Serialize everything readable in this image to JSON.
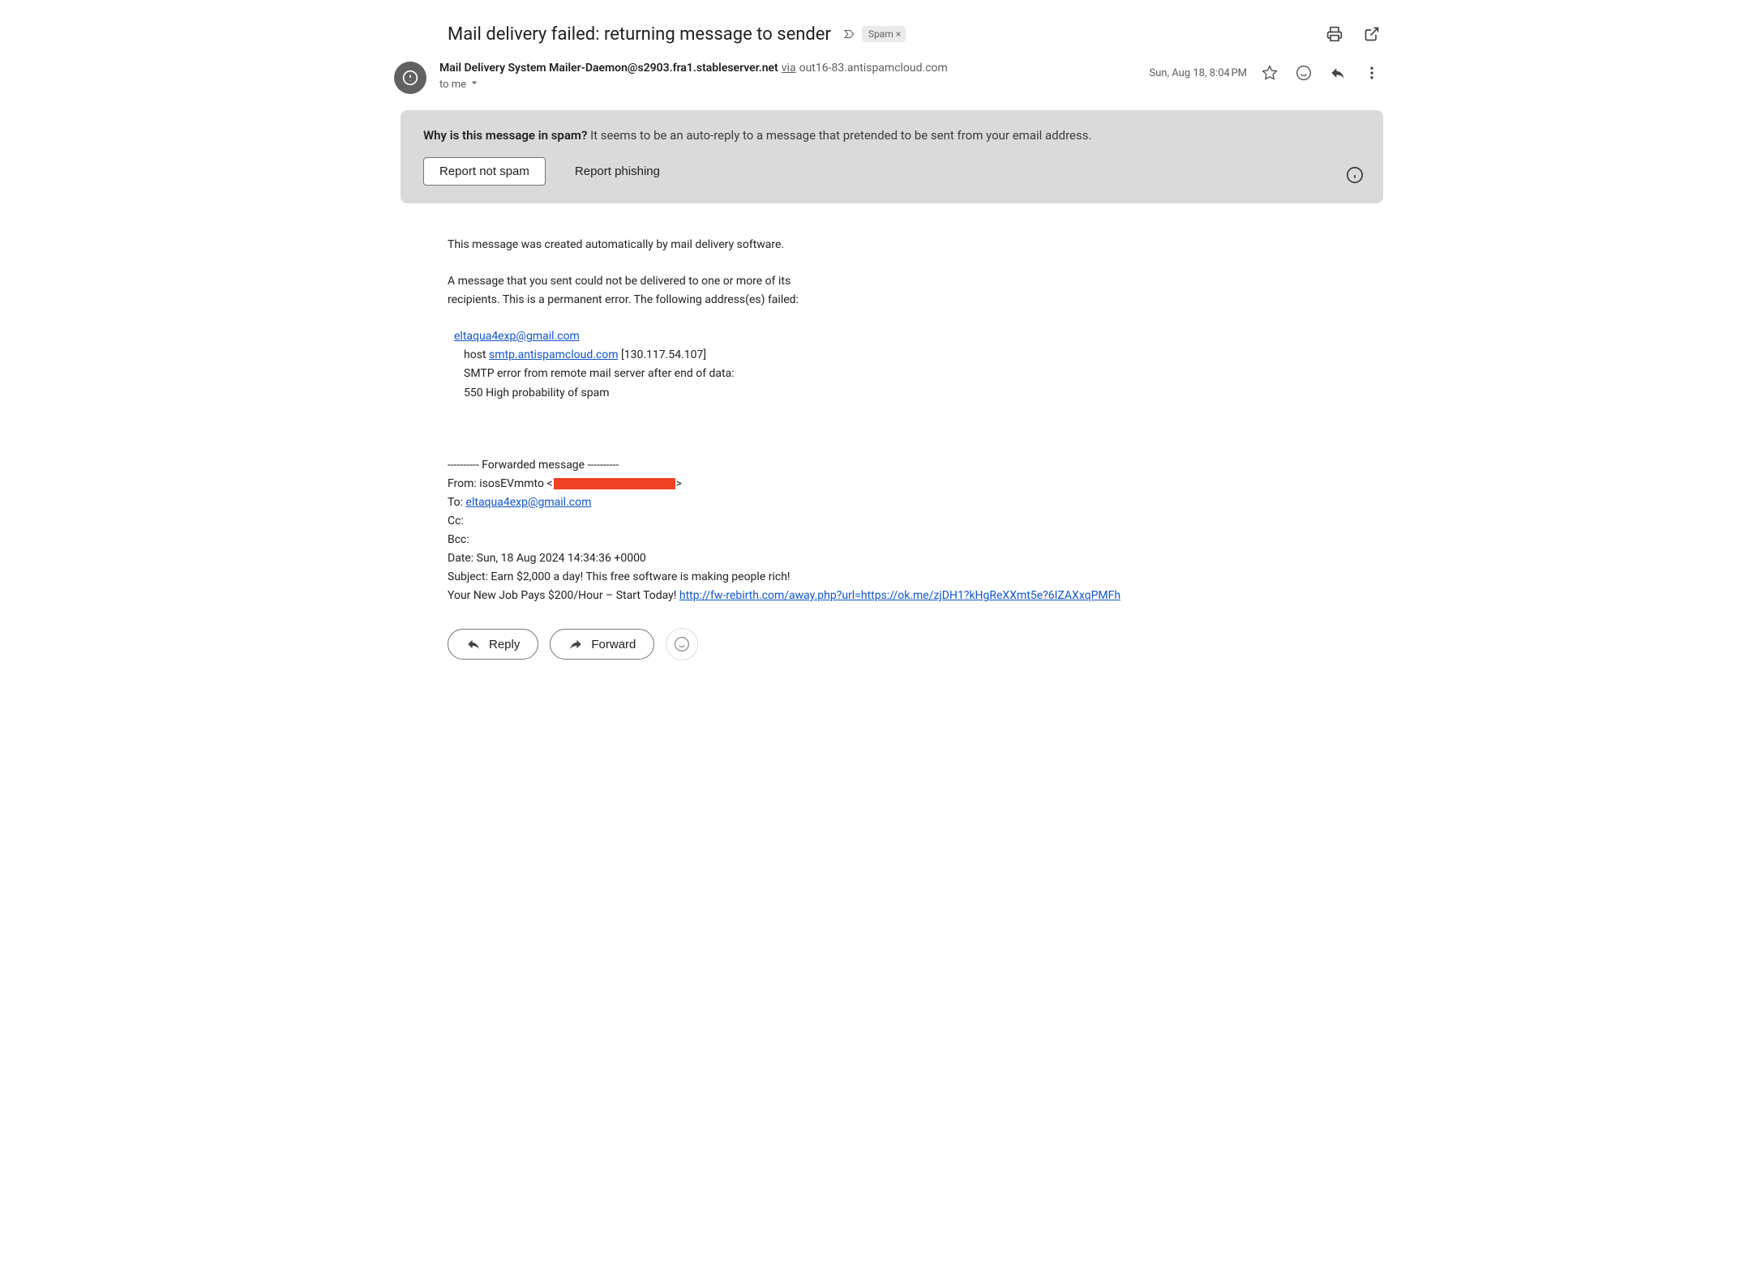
{
  "subject": "Mail delivery failed: returning message to sender",
  "spam_label": "Spam",
  "sender": {
    "name": "Mail Delivery System Mailer-Daemon@s2903.fra1.stableserver.net",
    "via_label": "via",
    "via_domain": "out16-83.antispamcloud.com",
    "recipient_prefix": "to me"
  },
  "timestamp": "Sun, Aug 18, 8:04 PM",
  "spam_banner": {
    "question": "Why is this message in spam?",
    "explanation": " It seems to be an auto-reply to a message that pretended to be sent from your email address.",
    "report_not_spam": "Report not spam",
    "report_phishing": "Report phishing"
  },
  "body": {
    "line1": "This message was created automatically by mail delivery software.",
    "line2": "A message that you sent could not be delivered to one or more of its",
    "line3": "recipients. This is a permanent error. The following address(es) failed:",
    "failed_email": "eltaqua4exp@gmail.com",
    "host_prefix": "host ",
    "host_link": "smtp.antispamcloud.com",
    "host_suffix": " [130.117.54.107]",
    "smtp_line": "SMTP error from remote mail server after end of data:",
    "error_line": "550 High probability of spam",
    "fwd_header": "---------- Forwarded message ----------",
    "from_prefix": "From: isosEVmmto <",
    "from_suffix": ">",
    "to_prefix": "To: ",
    "to_email": "eltaqua4exp@gmail.com",
    "cc": "Cc:",
    "bcc": "Bcc:",
    "date": "Date: Sun, 18 Aug 2024 14:34:36 +0000",
    "subject_line": "Subject: Earn $2,000 a day! This free software is making people rich!",
    "bodytext_prefix": "Your New Job Pays $200/Hour – Start Today! ",
    "bodytext_link": "http://fw-rebirth.com/away.php?url=https://ok.me/zjDH1?kHgReXXmt5e?6IZAXxqPMFh"
  },
  "actions": {
    "reply": "Reply",
    "forward": "Forward"
  }
}
